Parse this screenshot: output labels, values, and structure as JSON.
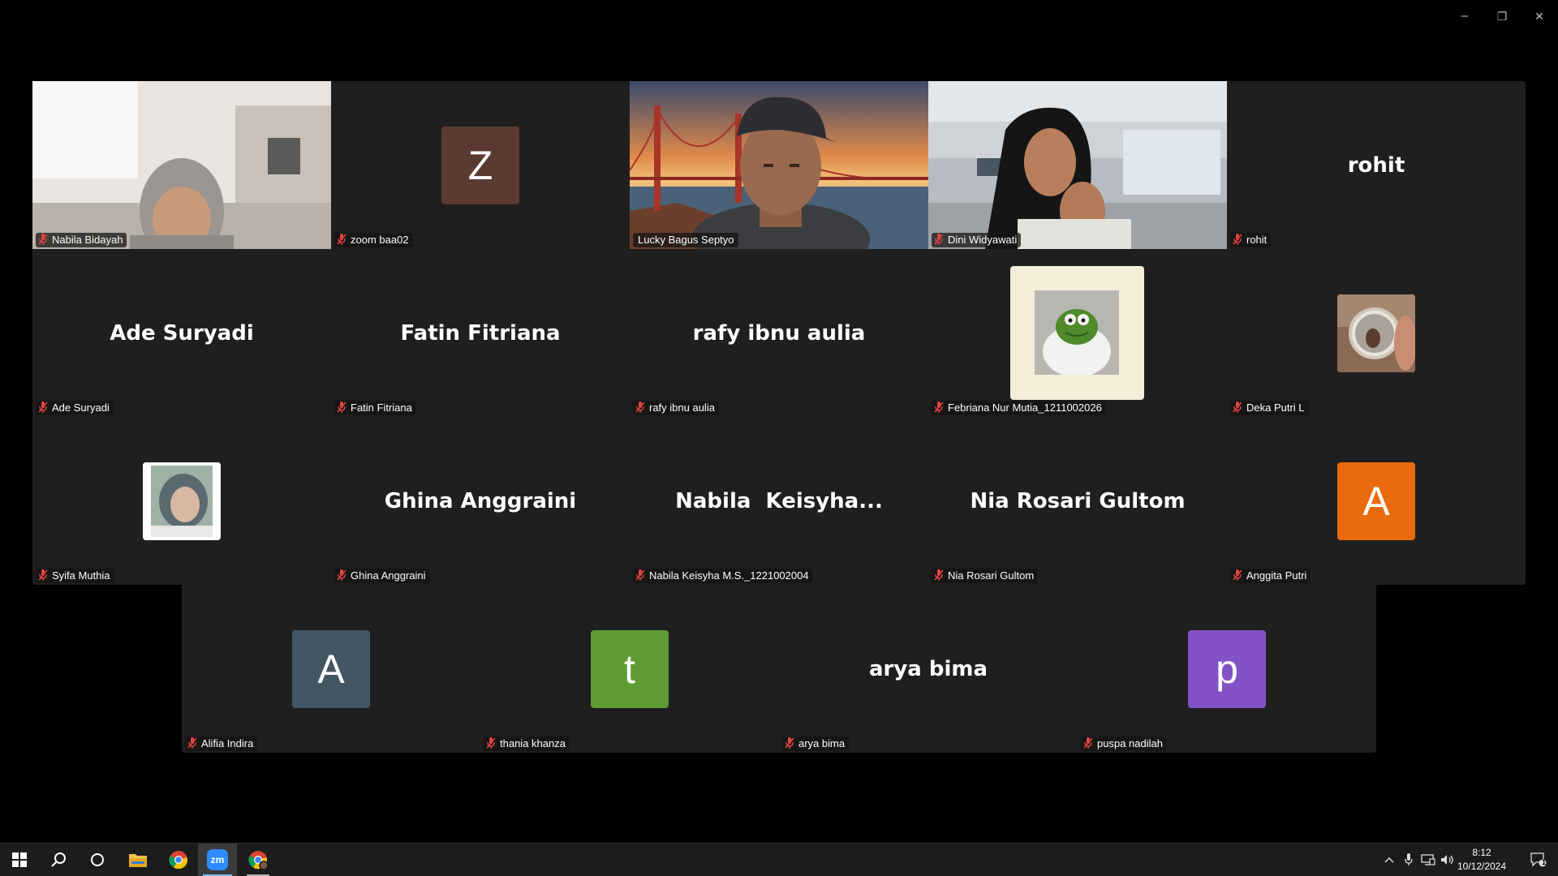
{
  "window": {
    "minimize": "–",
    "restore": "❐",
    "close": "✕"
  },
  "participants": [
    {
      "name": "Nabila Bidayah",
      "display": "video",
      "muted": true
    },
    {
      "name": "zoom baa02",
      "display": "avatar",
      "initial": "Z",
      "color": "#5a3a31",
      "muted": true
    },
    {
      "name": "Lucky Bagus Septyo",
      "display": "video",
      "muted": false,
      "speaking": true
    },
    {
      "name": "Dini Widyawati",
      "display": "video",
      "muted": true
    },
    {
      "name": "rohit",
      "display": "name",
      "label": "rohit",
      "muted": true
    },
    {
      "name": "Ade Suryadi",
      "display": "name",
      "label": "Ade Suryadi",
      "muted": true
    },
    {
      "name": "Fatin Fitriana",
      "display": "name",
      "label": "Fatin Fitriana",
      "muted": true
    },
    {
      "name": "rafy ibnu aulia",
      "display": "name",
      "label": "rafy ibnu aulia",
      "muted": true
    },
    {
      "name": "Febriana Nur Mutia_1211002026",
      "display": "picture",
      "muted": true
    },
    {
      "name": "Deka Putri L",
      "display": "picture",
      "muted": true
    },
    {
      "name": "Syifa Muthia",
      "display": "picture",
      "muted": true
    },
    {
      "name": "Ghina Anggraini",
      "display": "name",
      "label": "Ghina Anggraini",
      "muted": true
    },
    {
      "name": "Nabila Keisyha M.S._1221002004",
      "display": "name",
      "label": "Nabila  Keisyha...",
      "muted": true
    },
    {
      "name": "Nia Rosari Gultom",
      "display": "name",
      "label": "Nia Rosari Gultom",
      "muted": true
    },
    {
      "name": "Anggita Putri",
      "display": "avatar",
      "initial": "A",
      "color": "#e96a0c",
      "muted": true
    },
    {
      "name": "Alifia Indira",
      "display": "avatar",
      "initial": "A",
      "color": "#425663",
      "muted": true
    },
    {
      "name": "thania khanza",
      "display": "avatar",
      "initial": "t",
      "color": "#5e9b34",
      "muted": true
    },
    {
      "name": "arya bima",
      "display": "name",
      "label": "arya bima",
      "muted": true
    },
    {
      "name": "puspa nadilah",
      "display": "avatar",
      "initial": "p",
      "color": "#8352c6",
      "muted": true
    }
  ],
  "taskbar": {
    "zoom_label": "zm",
    "clock_time": "8:12",
    "clock_date": "10/12/2024",
    "notification_count": "1"
  }
}
